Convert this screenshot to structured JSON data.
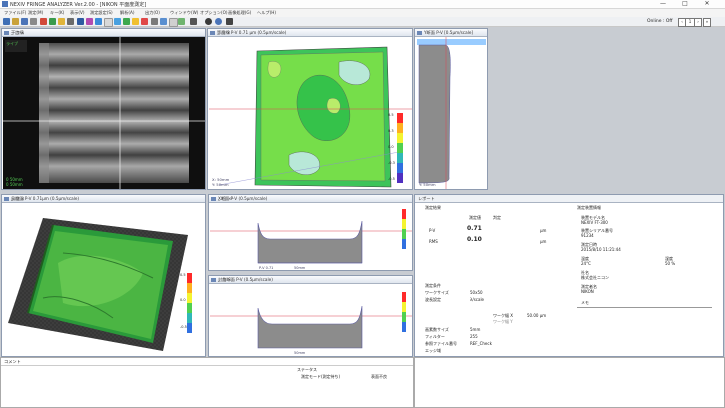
{
  "window": {
    "title": "NEXIV FRINGE ANALYZER Ver.2.00 - [NIKON 平面度測定]",
    "minimize": "—",
    "maximize": "□",
    "close": "✕"
  },
  "menu": [
    "ファイル(F)",
    "測定(M)",
    "キー(K)",
    "表示(V)",
    "測定設定(S)",
    "解析(A)",
    "出力(O)",
    "ウィンドウ(W)",
    "オプション(O)",
    "画像処理(G)",
    "ヘルプ(H)"
  ],
  "toolbar": {
    "online": "Online : Off",
    "page": "1"
  },
  "panels": {
    "camera": {
      "title": "干渉縞",
      "badge": "ライブ",
      "readout_x": "0   50mm",
      "readout_y": "0   50mm"
    },
    "contour": {
      "title": "等高線 P-V  0.71 µm (0.5µm/scale)",
      "readout_x": "X:   50mm",
      "readout_y": "Y:   50mm",
      "scale": [
        "0.5",
        "0.3",
        "0.0",
        "-0.3",
        "-0.5"
      ]
    },
    "ysection": {
      "title": "Y断面 P-V  [0.5µm/scale]",
      "readout": "Y:   50mm"
    },
    "iso": {
      "title": "鳥瞰図 P-V 0.71µm (0.5µm/scale)",
      "scale": [
        "0.5",
        "0.0",
        "-0.5"
      ]
    },
    "xsection": {
      "title": "X断面 P-V (0.5µm/scale)",
      "axis": [
        "P-V 0.71",
        "50mm"
      ]
    },
    "diag": {
      "title": "対角断面 P-V (0.5µm/scale)",
      "axis": [
        "50mm"
      ]
    }
  },
  "report": {
    "title": "レポート",
    "left": {
      "heading": "測定結果",
      "col_measured": "測定値",
      "col_judge": "判定",
      "rows": [
        {
          "label": "P-V",
          "value": "0.71",
          "unit": "µm"
        },
        {
          "label": "RMS",
          "value": "0.10",
          "unit": "µm"
        }
      ],
      "cond_heading": "測定条件",
      "conds": [
        {
          "label": "ワークサイズ",
          "value": "50x50"
        },
        {
          "label": "波長設定",
          "value": "λ/scale"
        }
      ],
      "warp_label": "ワーク幅 X",
      "warp_value": "50.00 µm",
      "warp_sub": "ワーク幅 Y",
      "conds2": [
        {
          "label": "画素数サイズ",
          "value": "5mm"
        },
        {
          "label": "フィルター",
          "value": "255"
        },
        {
          "label": "参照ファイル番号",
          "value": "REF_Check"
        },
        {
          "label": "エッジ域",
          "value": ""
        }
      ],
      "button": "詳細"
    },
    "right": {
      "heading": "測定装置情報",
      "items": [
        {
          "label": "装置モデル名",
          "value": "NEXIV FT-300"
        },
        {
          "label": "装置シリアル番号",
          "value": "91234"
        },
        {
          "label": "測定日時",
          "value": "2015/8/10 11:21:44"
        },
        {
          "label": "温度",
          "value": "24°C"
        },
        {
          "label": "湿度",
          "value": "50 %"
        },
        {
          "label": "社名",
          "value": "株式会社ニコン"
        },
        {
          "label": "測定者名",
          "value": "NIKON"
        },
        {
          "label": "メモ",
          "value": ""
        }
      ]
    }
  },
  "comment": {
    "title": "コメント",
    "status_title": "ステータス",
    "status_text": "測定モード(測定待ち)",
    "status_right": "表面不良"
  },
  "colors": {
    "panel_border": "#8e9bb0",
    "accent": "#6b87b6",
    "contour_green": "#35c24a",
    "section_fill": "#8c8c8c"
  }
}
